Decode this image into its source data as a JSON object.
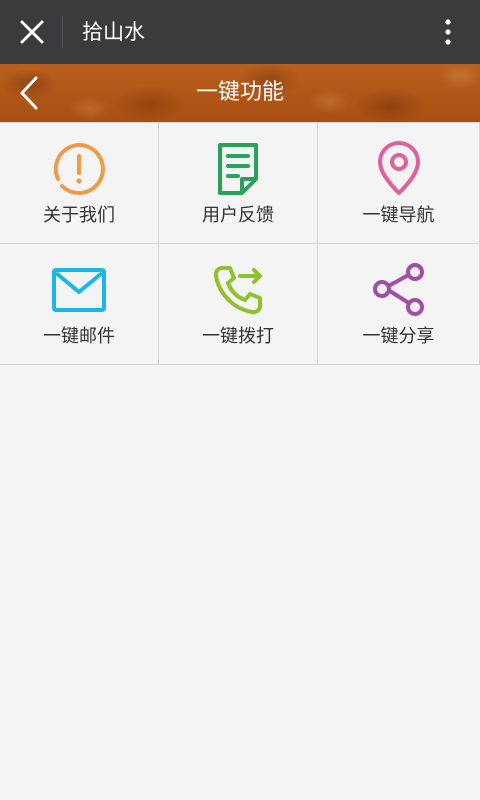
{
  "topbar": {
    "title": "拾山水",
    "close_icon": "close-icon",
    "more_icon": "more-vertical-icon"
  },
  "header": {
    "title": "一键功能",
    "back_icon": "chevron-left-icon"
  },
  "grid": {
    "items": [
      {
        "label": "关于我们",
        "icon": "info-exclamation-icon",
        "color": "#ef9a45"
      },
      {
        "label": "用户反馈",
        "icon": "feedback-document-icon",
        "color": "#2aa35a"
      },
      {
        "label": "一键导航",
        "icon": "location-pin-icon",
        "color": "#e0609a"
      },
      {
        "label": "一键邮件",
        "icon": "mail-icon",
        "color": "#1cb5e6"
      },
      {
        "label": "一键拨打",
        "icon": "phone-call-icon",
        "color": "#8dc22a"
      },
      {
        "label": "一键分享",
        "icon": "share-icon",
        "color": "#a04ea8"
      }
    ]
  },
  "colors": {
    "topbar_bg": "#3a3b3d",
    "header_bg": "#b4581a",
    "page_bg": "#f4f4f4",
    "grid_line": "#d6d6d6"
  }
}
